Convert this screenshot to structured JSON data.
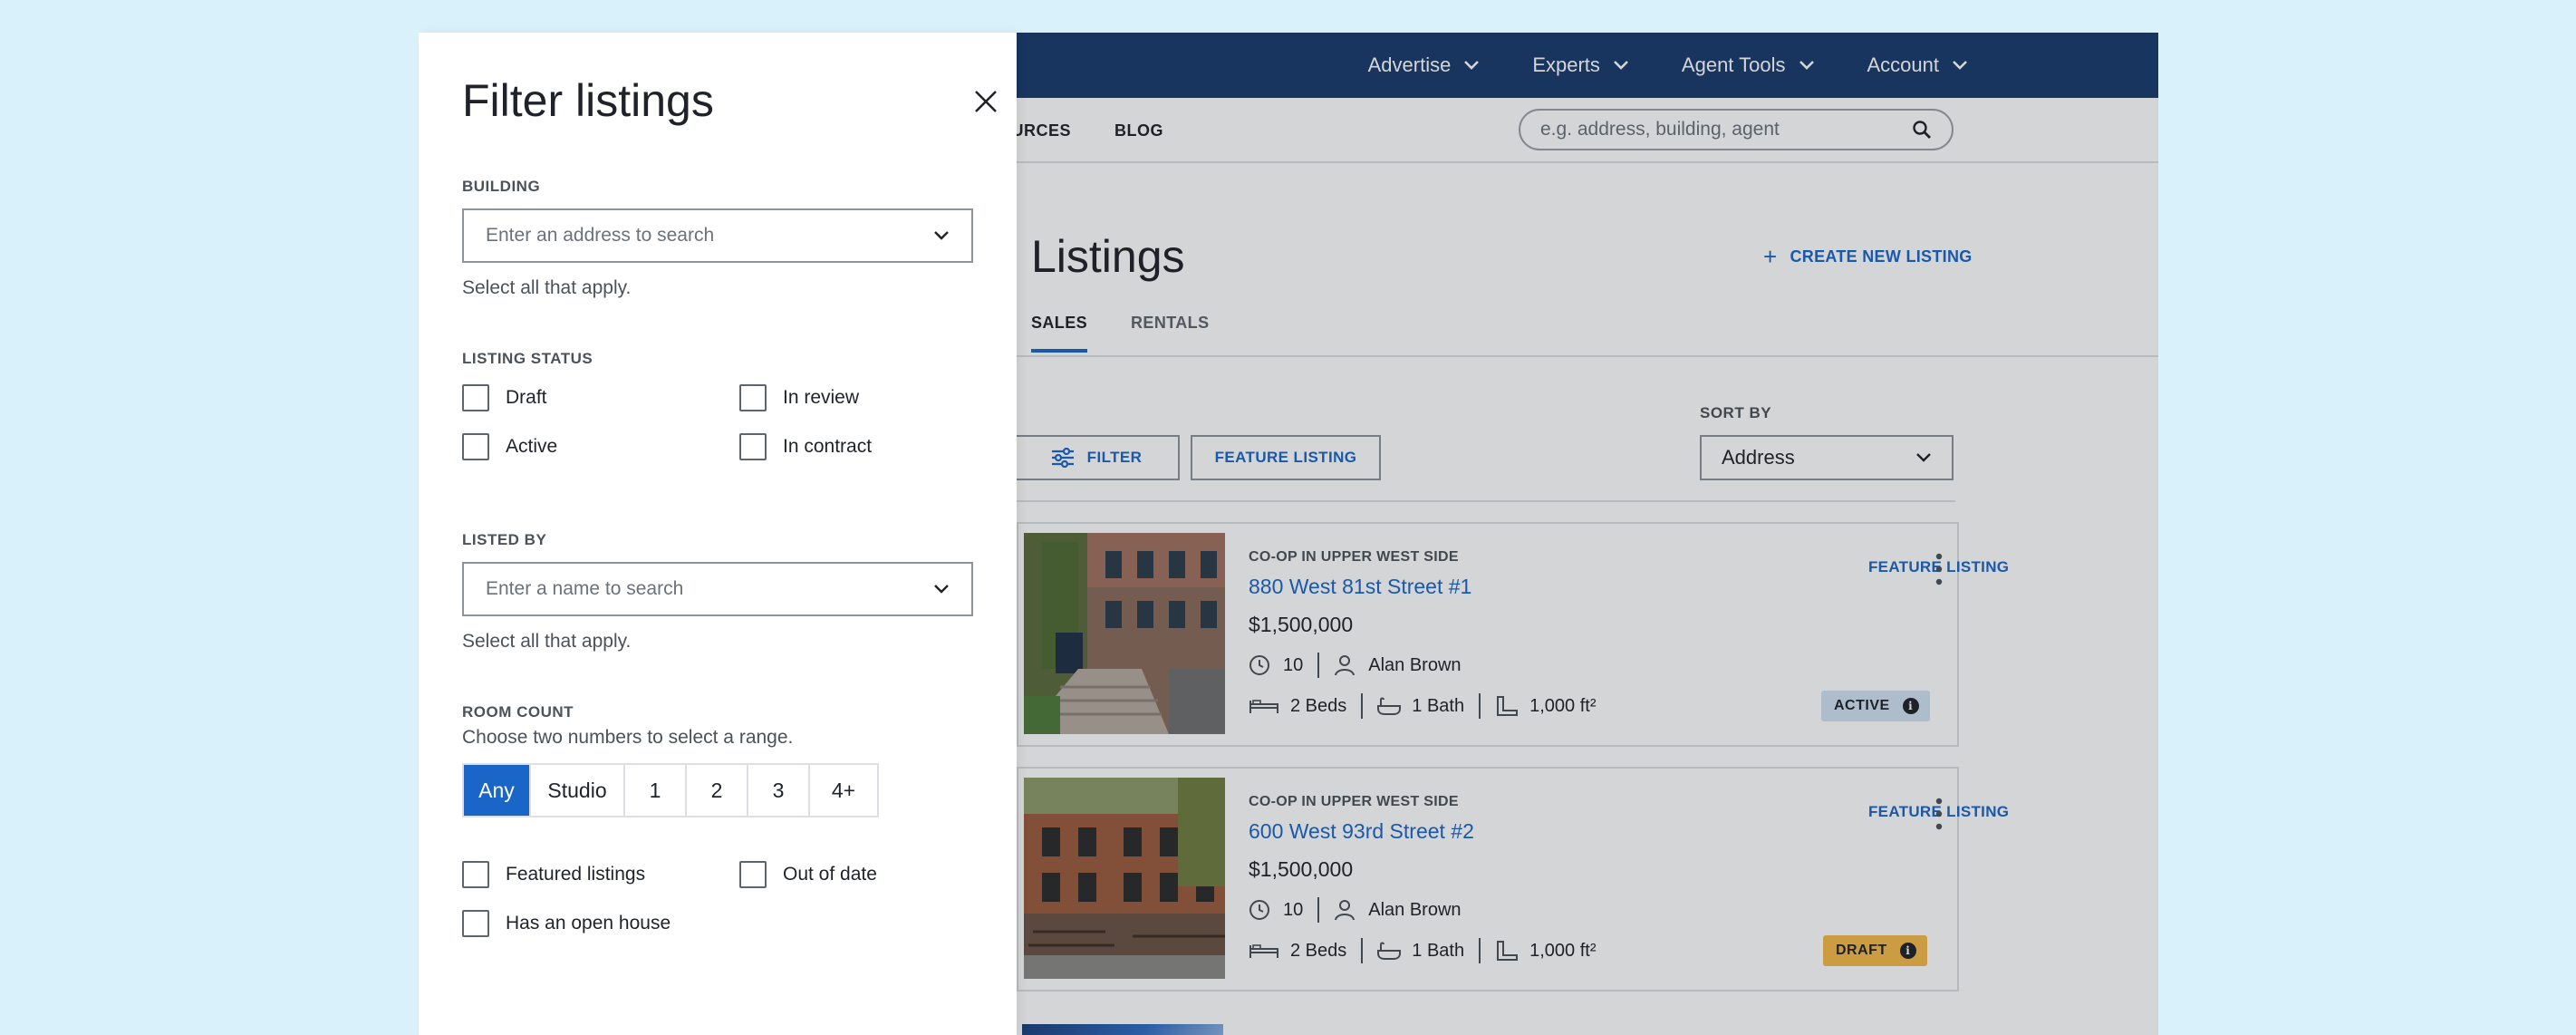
{
  "topnav": {
    "items": [
      {
        "label": "Advertise"
      },
      {
        "label": "Experts"
      },
      {
        "label": "Agent Tools"
      },
      {
        "label": "Account"
      }
    ]
  },
  "subnav": {
    "items": [
      {
        "label": "OURCES"
      },
      {
        "label": "BLOG"
      }
    ]
  },
  "search": {
    "placeholder": "e.g. address, building, agent"
  },
  "page": {
    "title": "Listings",
    "create_label": "CREATE NEW LISTING",
    "tabs": [
      {
        "label": "SALES"
      },
      {
        "label": "RENTALS"
      }
    ],
    "sort_label": "SORT BY",
    "sort_value": "Address",
    "filter_label": "FILTER",
    "feature_label": "FEATURE LISTING"
  },
  "listings": [
    {
      "type": "CO-OP IN UPPER WEST SIDE",
      "address": "880 West 81st Street #1",
      "price": "$1,500,000",
      "days": "10",
      "agent": "Alan Brown",
      "beds": "2 Beds",
      "baths": "1 Bath",
      "area": "1,000 ft²",
      "feature_label": "FEATURE LISTING",
      "status": "ACTIVE"
    },
    {
      "type": "CO-OP IN UPPER WEST SIDE",
      "address": "600 West 93rd Street #2",
      "price": "$1,500,000",
      "days": "10",
      "agent": "Alan Brown",
      "beds": "2 Beds",
      "baths": "1 Bath",
      "area": "1,000 ft²",
      "feature_label": "FEATURE LISTING",
      "status": "DRAFT"
    }
  ],
  "drawer": {
    "title": "Filter listings",
    "building": {
      "label": "BUILDING",
      "placeholder": "Enter an address to search",
      "hint": "Select all that apply."
    },
    "status": {
      "label": "LISTING STATUS",
      "options": [
        "Draft",
        "In review",
        "Active",
        "In contract"
      ]
    },
    "listed_by": {
      "label": "LISTED BY",
      "placeholder": "Enter a name to search",
      "hint": "Select all that apply."
    },
    "rooms": {
      "label": "ROOM COUNT",
      "hint": "Choose two numbers to select a range.",
      "options": [
        "Any",
        "Studio",
        "1",
        "2",
        "3",
        "4+"
      ],
      "selected": "Any"
    },
    "extras": [
      "Featured listings",
      "Out of date",
      "Has an open house"
    ]
  },
  "colors": {
    "navy": "#173a6d",
    "link_blue": "#1a66c8",
    "active_badge": "#cfe2f3",
    "draft_badge": "#f5b94a",
    "backdrop": "#d9f1fb"
  }
}
